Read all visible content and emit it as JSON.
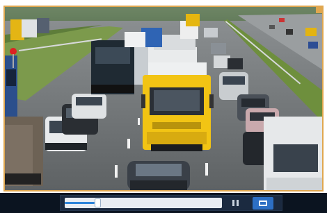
{
  "video": {
    "scene": "highway-traffic-camera-feed",
    "frame_border_color": "#e0a74f"
  },
  "controls": {
    "progress": 0.19,
    "accent_color": "#2d84d9",
    "pause_icon": "pause-icon",
    "fullscreen_icon": "fullscreen-icon"
  }
}
